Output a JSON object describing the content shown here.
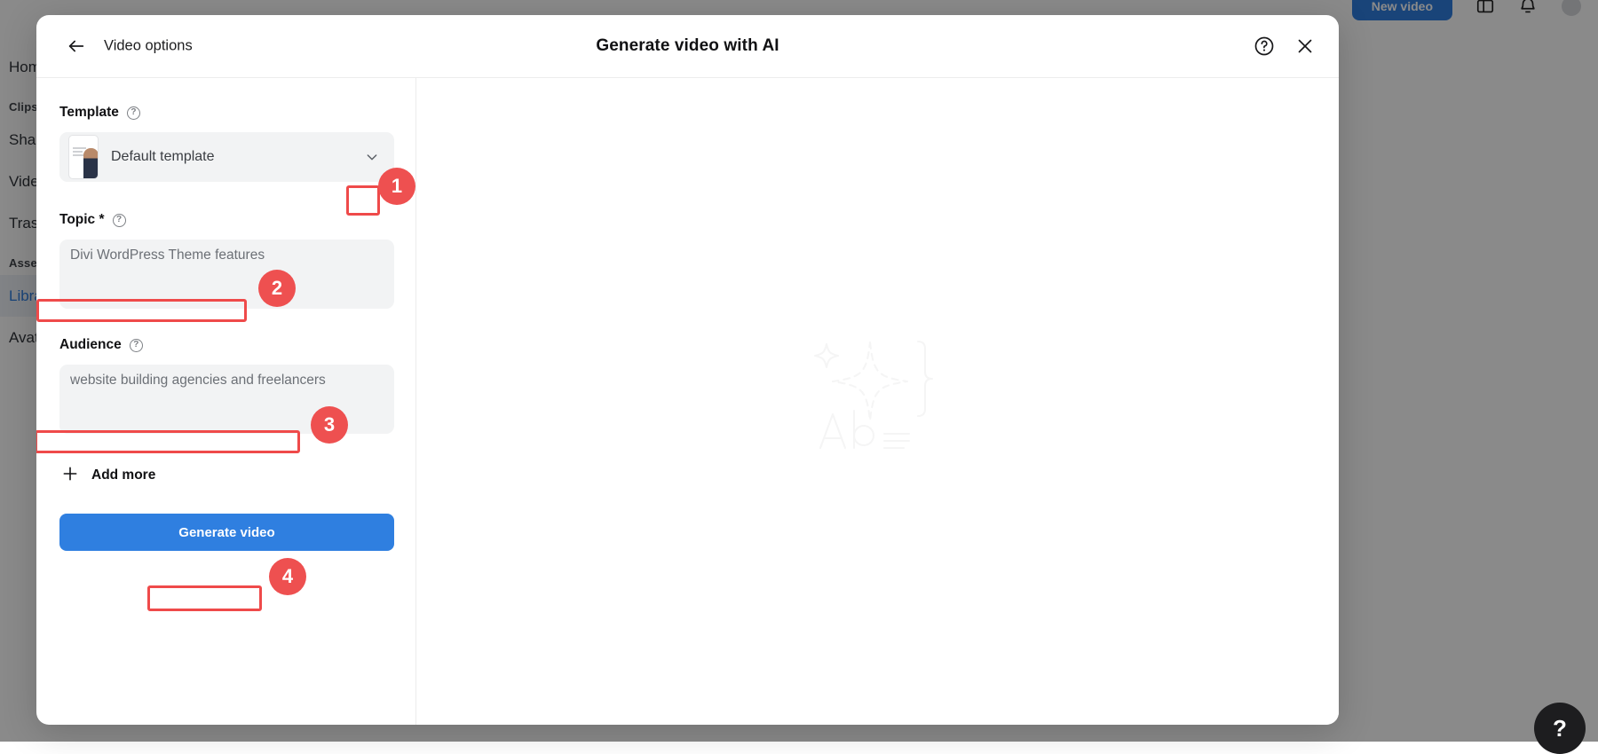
{
  "background_app": {
    "new_video_button": "New video",
    "topbar_icons": [
      "panel-icon",
      "bell-icon",
      "avatar-icon"
    ],
    "sidebar": {
      "items": [
        {
          "label": "Home",
          "icon": "home-icon",
          "active": false,
          "type": "item"
        },
        {
          "label": "Clips",
          "type": "section"
        },
        {
          "label": "Shared with me",
          "icon": "share-icon",
          "active": false,
          "type": "item"
        },
        {
          "label": "Videos",
          "icon": "video-icon",
          "active": false,
          "type": "item"
        },
        {
          "label": "Trash",
          "icon": "trash-icon",
          "active": false,
          "type": "item"
        },
        {
          "label": "Assets",
          "type": "section"
        },
        {
          "label": "Library",
          "icon": "library-icon",
          "active": true,
          "type": "item"
        },
        {
          "label": "Avatars",
          "icon": "avatar-icon",
          "active": false,
          "type": "item"
        }
      ]
    },
    "help_fab": "?"
  },
  "modal": {
    "back_label": "Video options",
    "title": "Generate video with AI",
    "header_icons": {
      "help": "help-circle-icon",
      "close": "close-icon"
    },
    "fields": {
      "template": {
        "label": "Template",
        "help": "?",
        "value": "Default template",
        "caret": "chevron-down-icon"
      },
      "topic": {
        "label": "Topic *",
        "help": "?",
        "value": "Divi WordPress Theme features",
        "placeholder": "Divi WordPress Theme features"
      },
      "audience": {
        "label": "Audience",
        "help": "?",
        "value": "website building agencies and freelancers",
        "placeholder": "website building agencies and freelancers"
      }
    },
    "add_more": {
      "label": "Add more",
      "icon": "plus-icon"
    },
    "generate_button": "Generate video"
  },
  "annotations": {
    "badges": [
      {
        "number": "1",
        "target": "template-dropdown-caret"
      },
      {
        "number": "2",
        "target": "topic-input"
      },
      {
        "number": "3",
        "target": "audience-input"
      },
      {
        "number": "4",
        "target": "generate-video-button"
      }
    ],
    "accent_color": "#ee5050"
  },
  "colors": {
    "primary_button": "#2f7fe0",
    "field_background": "#f2f3f4",
    "annotation_red": "#ee5050",
    "sidebar_active": "#2f7fe0"
  }
}
